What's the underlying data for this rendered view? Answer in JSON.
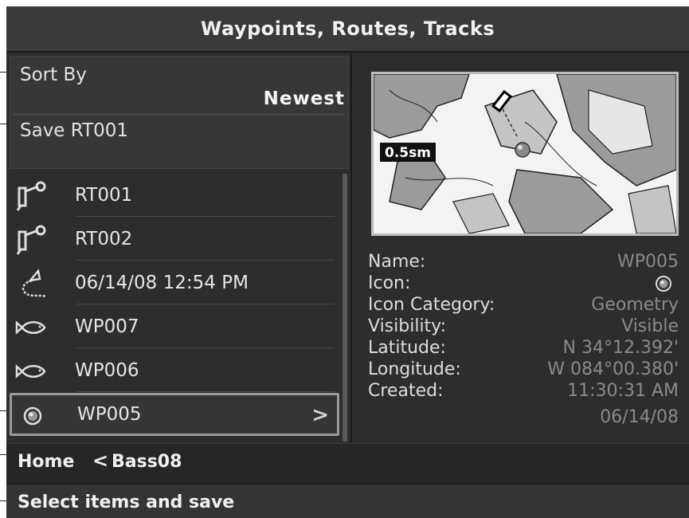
{
  "title": "Waypoints, Routes, Tracks",
  "sort": {
    "label": "Sort By",
    "value": "Newest"
  },
  "save": {
    "label": "Save RT001"
  },
  "items": [
    {
      "label": "RT001",
      "icon": "route-icon"
    },
    {
      "label": "RT002",
      "icon": "route-icon"
    },
    {
      "label": "06/14/08 12:54 PM",
      "icon": "track-icon"
    },
    {
      "label": "WP007",
      "icon": "fish-icon"
    },
    {
      "label": "WP006",
      "icon": "fish-icon"
    },
    {
      "label": "WP005",
      "icon": "sphere-icon",
      "chevron": ">"
    }
  ],
  "map": {
    "scale": "0.5sm"
  },
  "details": [
    {
      "label": "Name:",
      "value": "WP005"
    },
    {
      "label": "Icon:",
      "value": ""
    },
    {
      "label": "Icon Category:",
      "value": "Geometry"
    },
    {
      "label": "Visibility:",
      "value": "Visible"
    },
    {
      "label": "Latitude:",
      "value": "N 34°12.392'"
    },
    {
      "label": "Longitude:",
      "value": "W 084°00.380'"
    },
    {
      "label": "Created:",
      "value": "11:30:31 AM"
    },
    {
      "label": "",
      "value": "06/14/08"
    }
  ],
  "breadcrumb": {
    "home": "Home",
    "separator": "<",
    "current": "Bass08"
  },
  "status": "Select items and save",
  "colors": {
    "background": "#2b2b2b",
    "text": "#e6e6e6",
    "muted_value": "#8a8a8a",
    "selection_border": "#9a9a9a"
  }
}
